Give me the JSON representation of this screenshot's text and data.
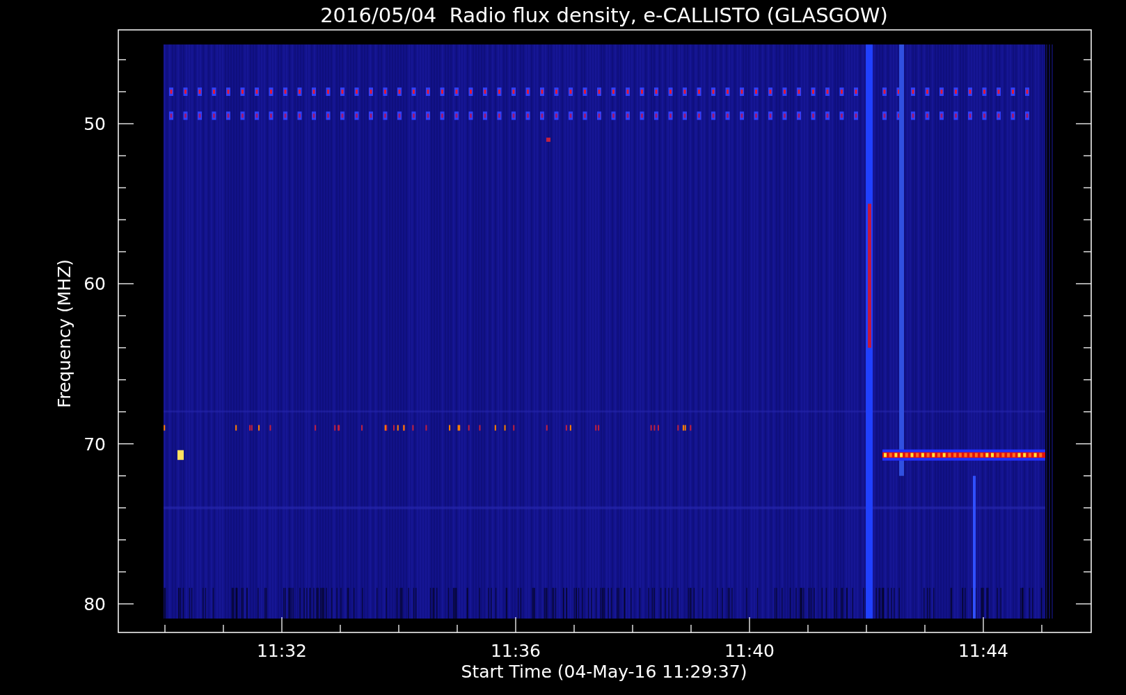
{
  "title": "2016/05/04  Radio flux density, e-CALLISTO (GLASGOW)",
  "ylabel": "Frequency (MHZ)",
  "xlabel": "Start Time (04-May-16 11:29:37)",
  "yticks": [
    "50",
    "60",
    "70",
    "80"
  ],
  "xticks": [
    "11:32",
    "11:36",
    "11:40",
    "11:44"
  ]
}
